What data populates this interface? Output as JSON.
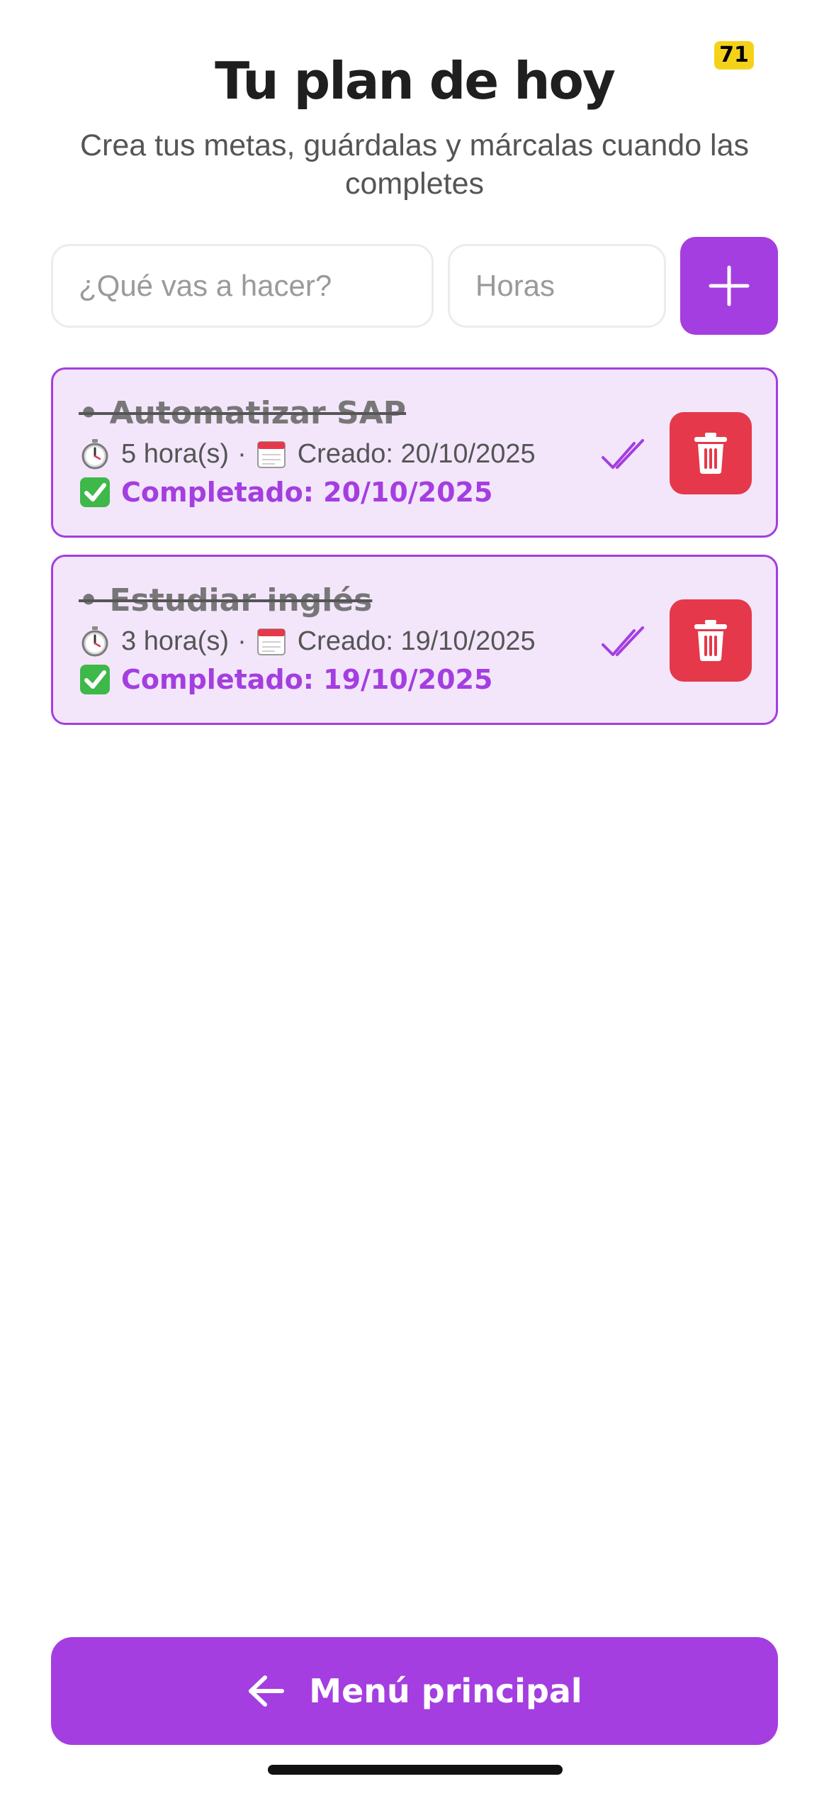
{
  "status_badge": "71",
  "header": {
    "title": "Tu plan de hoy",
    "subtitle": "Crea tus metas, guárdalas y márcalas cuando las completes"
  },
  "form": {
    "task_placeholder": "¿Qué vas a hacer?",
    "task_value": "",
    "hours_placeholder": "Horas",
    "hours_value": "",
    "add_icon": "plus-icon"
  },
  "tasks": [
    {
      "title": "• Automatizar SAP",
      "hours": "5 hora(s)",
      "created": "Creado: 20/10/2025",
      "completed": "Completado: 20/10/2025",
      "status": "completed"
    },
    {
      "title": "• Estudiar inglés",
      "hours": "3 hora(s)",
      "created": "Creado: 19/10/2025",
      "completed": "Completado: 19/10/2025",
      "status": "completed"
    }
  ],
  "meta_separator": "·",
  "icons": {
    "hours": "stopwatch-icon",
    "created": "calendar-icon",
    "completed": "check-mark-icon",
    "toggle": "double-check-icon",
    "delete": "trash-icon",
    "back": "arrow-left-icon"
  },
  "footer": {
    "menu_label": "Menú principal"
  },
  "colors": {
    "accent": "#a43ee0",
    "card_bg": "#f3e6fb",
    "danger": "#e5384a",
    "badge": "#f5d21a",
    "check_green": "#3fb84a"
  }
}
